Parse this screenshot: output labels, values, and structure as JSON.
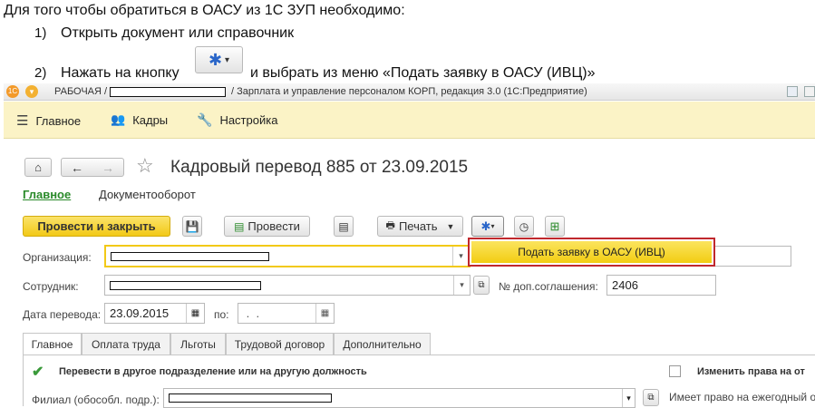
{
  "instructions": {
    "intro": "Для того чтобы обратиться в ОАСУ из 1С ЗУП необходимо:",
    "step1_num": "1)",
    "step1": "Открыть документ или справочник",
    "step2_num": "2)",
    "step2_a": "Нажать на кнопку",
    "step2_b": "и выбрать из меню «Подать заявку в ОАСУ (ИВЦ)»"
  },
  "window": {
    "title_prefix": "РАБОЧАЯ /",
    "title_suffix": "/ Зарплата и управление персоналом КОРП, редакция 3.0  (1С:Предприятие)"
  },
  "sections": {
    "main": "Главное",
    "staff": "Кадры",
    "settings": "Настройка"
  },
  "document": {
    "title": "Кадровый перевод 885 от 23.09.2015",
    "nav_main": "Главное",
    "nav_docflow": "Документооборот"
  },
  "toolbar": {
    "post_close": "Провести и закрыть",
    "post": "Провести",
    "print": "Печать",
    "popup_item": "Подать заявку в ОАСУ (ИВЦ)"
  },
  "form": {
    "org_label": "Организация:",
    "employee_label": "Сотрудник:",
    "agreement_label": "№ доп.соглашения:",
    "agreement_value": "2406",
    "date_label": "Дата перевода:",
    "date_value": "23.09.2015",
    "to_label": "по:",
    "to_value": " .  .  "
  },
  "tabs": [
    "Главное",
    "Оплата труда",
    "Льготы",
    "Трудовой договор",
    "Дополнительно"
  ],
  "tab_content": {
    "transfer_check": "Перевести в другое подразделение или на другую должность",
    "change_rights": "Изменить права на от",
    "branch_label": "Филиал (обособл. подр.):",
    "vacation_right": "Имеет право на ежегодный о"
  },
  "colors": {
    "accent_yellow": "#f5d21e",
    "menu_bar": "#fbf3c6",
    "popup_border": "#c0282d",
    "check_green": "#3a9a3a"
  }
}
